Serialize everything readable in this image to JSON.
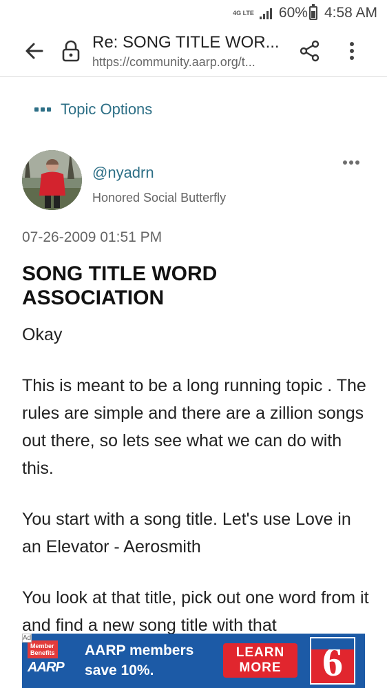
{
  "status_bar": {
    "network_type": "4G LTE",
    "battery": "60%",
    "time": "4:58 AM"
  },
  "browser": {
    "page_title": "Re: SONG TITLE WOR...",
    "url": "https://community.aarp.org/t..."
  },
  "topic_options_label": "Topic Options",
  "post": {
    "username": "@nyadrn",
    "rank": "Honored Social Butterfly",
    "date": "07-26-2009 01:51 PM",
    "title": "SONG TITLE WORD ASSOCIATION",
    "body": [
      "Okay",
      "This is meant to be a long running topic . The rules are simple and there are a zillion songs out there, so lets see what we can do with this.",
      "You start with a song title.  Let's use  Love in an Elevator - Aerosmith",
      "You look at that title, pick out one word from it and find a new song title with that"
    ]
  },
  "ad": {
    "label": "Ad",
    "logo_tag": "Member Benefits",
    "logo_brand": "AARP",
    "headline": "AARP members",
    "subline": "save 10%.",
    "cta": "LEARN MORE",
    "brand_mark": "6"
  },
  "colors": {
    "link": "#2d6f86",
    "ad_background": "#1c5aa6",
    "ad_cta": "#e1262e"
  }
}
